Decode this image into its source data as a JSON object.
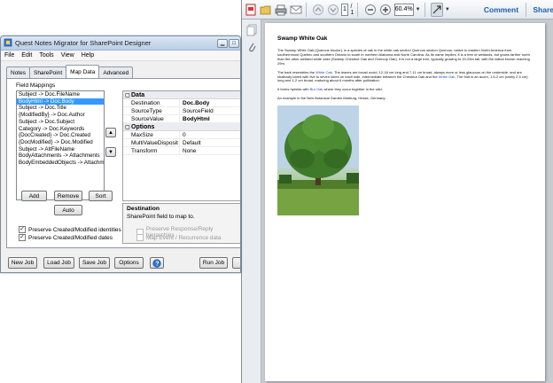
{
  "app": {
    "title": "Quest Notes Migrator for SharePoint Designer",
    "menu": [
      "File",
      "Edit",
      "Tools",
      "View",
      "Help"
    ],
    "tabs": [
      "Notes",
      "SharePoint",
      "Map Data",
      "Advanced"
    ],
    "active_tab": "Map Data",
    "field_mappings_label": "Field Mappings",
    "mappings": [
      "Subject -> Doc.FileName",
      "BodyHtml -> Doc.Body",
      "Subject -> Doc.Title",
      "{ModifiedBy} -> Doc.Author",
      "Subject -> Doc.Subject",
      "Category -> Doc.Keywords",
      "{DocCreated} -> Doc.Created",
      "{DocModified} -> Doc.Modified",
      "Subject -> AltFileName",
      "BodyAttachments -> Attachments",
      "BodyEmbeddedObjects -> Attachm"
    ],
    "selected_mapping": 1,
    "buttons": {
      "add": "Add",
      "remove": "Remove",
      "sort": "Sort",
      "auto": "Auto"
    },
    "property_grid": {
      "categories": [
        {
          "name": "Data",
          "rows": [
            {
              "name": "Destination",
              "value": "Doc.Body",
              "bold": true
            },
            {
              "name": "SourceType",
              "value": "SourceField",
              "bold": false
            },
            {
              "name": "SourceValue",
              "value": "BodyHtml",
              "bold": true
            }
          ]
        },
        {
          "name": "Options",
          "rows": [
            {
              "name": "MaxSize",
              "value": "0",
              "bold": false
            },
            {
              "name": "MultiValueDisposit",
              "value": "Default",
              "bold": false
            },
            {
              "name": "Transform",
              "value": "None",
              "bold": false
            }
          ]
        }
      ],
      "desc_title": "Destination",
      "desc_text": "SharePoint field to map to."
    },
    "checks": {
      "preserve_identities": {
        "label": "Preserve Created/Modified identities",
        "checked": true
      },
      "preserve_dates": {
        "label": "Preserve Created/Modified dates",
        "checked": true
      },
      "preserve_hierarchies": {
        "label": "Preserve Response/Reply hierarchies",
        "checked": false
      },
      "map_event": {
        "label": "Map Event / Recurrence data",
        "checked": false
      }
    },
    "footer_buttons": {
      "new_job": "New Job",
      "load_job": "Load Job",
      "save_job": "Save Job",
      "options": "Options",
      "run_job": "Run Job"
    }
  },
  "pdf": {
    "page_current": "1",
    "page_total": "/ 1",
    "zoom": "60.4%",
    "comment": "Comment",
    "share": "Share",
    "doc_title": "Swamp White Oak",
    "p1": "The Swamp White Oak (Quercus bicolor), is a species of oak in the white oak section Quercus section Quercus, native to eastern North America from southernmost Quebec and southern Ontario to south in northern Alabama and North Carolina. As its name implies, it is a tree of wetlands, but grows farther north than the other wetland white oaks (Swamp Chestnut Oak and Overcup Oak). It is not a large tree, typically growing to 20-25m tall, with the tallest known reaching 29m.",
    "p2a": "The bark resembles the ",
    "p2_link1": "White Oak",
    "p2b": ". The leaves are broad ovoid, 12-18 cm long and 7-11 cm broad, always more or less glaucous on the underside, and are shallowly lobed with five to seven lobes on each side, intermediate between the Chestnut Oak and the ",
    "p2_link2": "White Oak",
    "p2c": ". The fruit is an acorn, 1.5-2 cm (rarely 2.5 cm) long and 1-2 cm broad, maturing about 6 months after pollination.",
    "p3a": "It forms hybrids with ",
    "p3_link": "Bur Oak",
    "p3b": " where they occur together in the wild.",
    "p4": "An example in the New Botanical Garden Marburg, Hesse, Germany:"
  }
}
